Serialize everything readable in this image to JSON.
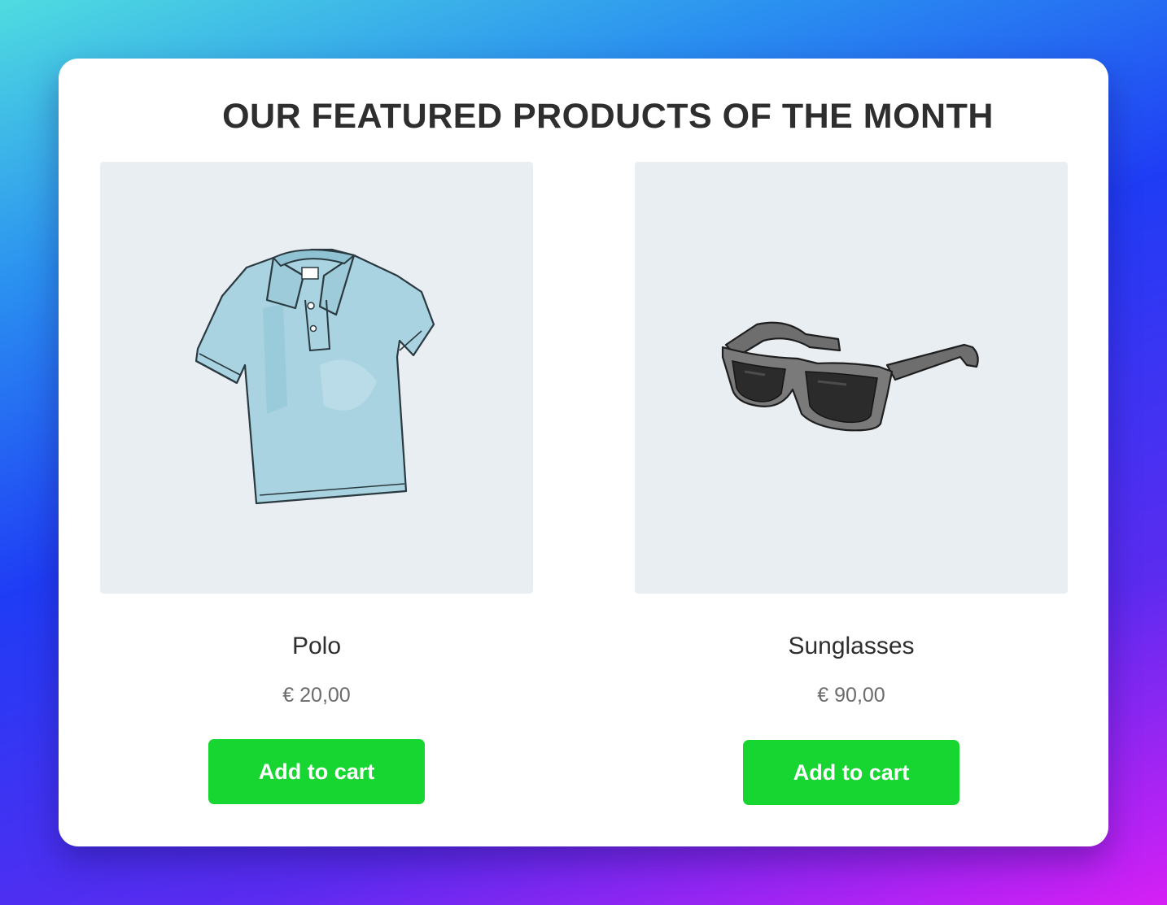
{
  "header": {
    "title": "OUR FEATURED PRODUCTS OF THE MONTH"
  },
  "products": [
    {
      "name": "Polo",
      "price": "€ 20,00",
      "button_label": "Add to cart",
      "image_icon": "polo-shirt-icon",
      "image_color": "#a9d3e0"
    },
    {
      "name": "Sunglasses",
      "price": "€ 90,00",
      "button_label": "Add to cart",
      "image_icon": "sunglasses-icon",
      "image_color": "#5a5a5a"
    }
  ],
  "colors": {
    "button": "#17d632",
    "image_background": "#e9eef3",
    "title_text": "#2e2e2e",
    "price_text": "#6b6b6b"
  }
}
